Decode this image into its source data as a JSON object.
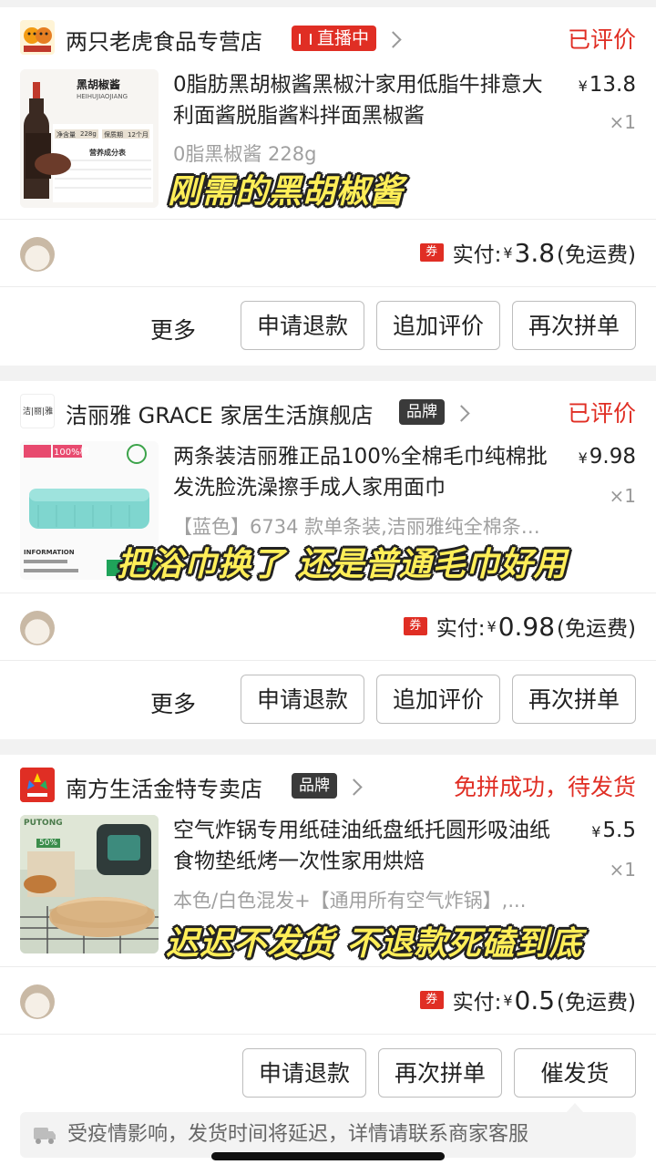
{
  "orders": [
    {
      "store_name": "两只老虎食品专营店",
      "store_badge": "直播中",
      "status": "已评价",
      "product_title": "0脂肪黑胡椒酱黑椒汁家用低脂牛排意大利面酱脱脂酱料拌面黑椒酱",
      "price_symbol": "¥",
      "price": "13.8",
      "quantity": "×1",
      "spec": "0脂黑椒酱 228g",
      "overlay_caption": "刚需的黑胡椒酱",
      "coupon_label": "券",
      "paid_label": "实付:",
      "paid_symbol": "¥",
      "paid_amount": "3.8",
      "shipping_note": "(免运费)",
      "actions": [
        "更多",
        "申请退款",
        "追加评价",
        "再次拼单"
      ],
      "thumb_text": {
        "name": "黑胡椒酱",
        "pinyin": "HEIHUJIAOJIANG",
        "net": "净含量",
        "weight": "228g",
        "shelf": "保质期",
        "months": "12个月",
        "table_title": "营养成分表"
      }
    },
    {
      "store_logo_text": "洁|丽|雅",
      "store_name": "洁丽雅 GRACE 家居生活旗舰店",
      "store_badge": "品牌",
      "status": "已评价",
      "product_title": "两条装洁丽雅正品100%全棉毛巾纯棉批发洗脸洗澡擦手成人家用面巾",
      "price_symbol": "¥",
      "price": "9.98",
      "quantity": "×1",
      "spec": "【蓝色】6734 款单条装,洁丽雅纯全棉条…",
      "overlay_caption": "把浴巾换了 还是普通毛巾好用",
      "coupon_label": "券",
      "paid_label": "实付:",
      "paid_symbol": "¥",
      "paid_amount": "0.98",
      "shipping_note": "(免运费)",
      "actions": [
        "更多",
        "申请退款",
        "追加评价",
        "再次拼单"
      ],
      "thumb_text": {
        "tag": "100%棉",
        "info": "INFORMATION"
      }
    },
    {
      "store_name": "南方生活金特专卖店",
      "store_badge": "品牌",
      "status": "免拼成功，待发货",
      "product_title": "空气炸锅专用纸硅油纸盘纸托圆形吸油纸食物垫纸烤一次性家用烘焙",
      "price_symbol": "¥",
      "price": "5.5",
      "quantity": "×1",
      "spec": "本色/白色混发+【通用所有空气炸锅】,...",
      "overlay_caption": "迟迟不发货 不退款死磕到底",
      "coupon_label": "券",
      "paid_label": "实付:",
      "paid_symbol": "¥",
      "paid_amount": "0.5",
      "shipping_note": "(免运费)",
      "actions": [
        "申请退款",
        "再次拼单",
        "催发货"
      ],
      "thumb_text": {
        "brand": "PUTONG",
        "pct": "50%"
      }
    }
  ],
  "notice": "受疫情影响，发货时间将延迟，详情请联系商家客服",
  "colors": {
    "accent": "#e02e24",
    "overlay_text": "#ffee58",
    "badge_dark": "#3a3a3a"
  }
}
